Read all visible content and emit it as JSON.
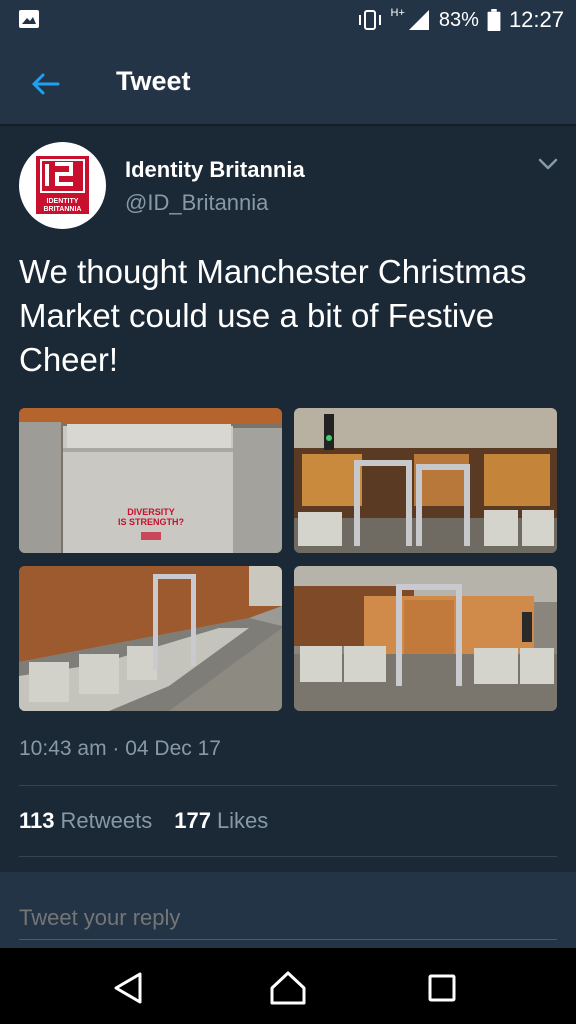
{
  "status_bar": {
    "network_badge": "H+",
    "battery_percent": "83%",
    "time": "12:27",
    "icons": [
      "gallery-icon",
      "vibrate-icon",
      "signal-icon",
      "battery-icon"
    ]
  },
  "app_bar": {
    "title": "Tweet",
    "back_icon": "arrow-left-icon"
  },
  "tweet": {
    "display_name": "Identity Britannia",
    "handle": "@ID_Britannia",
    "avatar_text": [
      "IDENTITY",
      "BRITANNIA"
    ],
    "text": "We thought Manchester Christmas Market could use a bit of Festive Cheer!",
    "photo_texts": [
      "DIVERSITY",
      "IS STRENGTH?"
    ],
    "timestamp": "10:43 am · 04 Dec 17",
    "retweets_count": "113",
    "retweets_label": "Retweets",
    "likes_count": "177",
    "likes_label": "Likes"
  },
  "reply": {
    "placeholder": "Tweet your reply"
  },
  "nav_bar": {
    "icons": [
      "nav-back-icon",
      "nav-home-icon",
      "nav-recents-icon"
    ]
  },
  "colors": {
    "background": "#1b2836",
    "bar": "#243447",
    "accent": "#1da1f2",
    "muted_text": "#8899a6",
    "brand_red": "#c8102e"
  }
}
